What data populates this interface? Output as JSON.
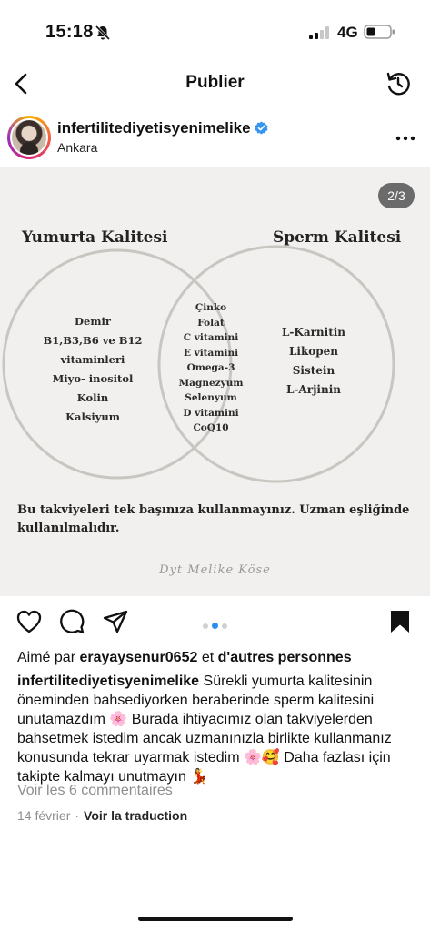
{
  "status_bar": {
    "time": "15:18",
    "network": "4G"
  },
  "header": {
    "title": "Publier"
  },
  "post": {
    "username": "infertilitediyetisyenimelike",
    "location": "Ankara",
    "page_indicator": "2/3"
  },
  "image": {
    "left_title": "Yumurta Kalitesi",
    "right_title": "Sperm Kalitesi",
    "left_items": [
      "Demir",
      "B1,B3,B6 ve B12",
      "vitaminleri",
      "Miyo- inositol",
      "Kolin",
      "Kalsiyum"
    ],
    "center_items": [
      "Çinko",
      "Folat",
      "C vitamini",
      "E vitamini",
      "Omega-3",
      "Magnezyum",
      "Selenyum",
      "D vitamini",
      "CoQ10"
    ],
    "right_items": [
      "L-Karnitin",
      "Likopen",
      "Sistein",
      "L-Arjinin"
    ],
    "warning": "Bu takviyeleri tek başınıza kullanmayınız. Uzman eşliğinde kullanılmalıdır.",
    "signature": "Dyt Melike Köse"
  },
  "likes": {
    "prefix": "Aimé par",
    "user": "erayaysenur0652",
    "middle": "et",
    "suffix": "d'autres personnes"
  },
  "caption": {
    "user": "infertilitediyetisyenimelike",
    "text": "Sürekli yumurta kalitesinin öneminden bahsediyorken beraberinde sperm kalitesini unutamazdım 🌸 Burada ihtiyacımız olan takviyelerden bahsetmek istedim ancak uzmanınızla birlikte kullanmanız konusunda tekrar uyarmak istedim 🌸🥰 Daha fazlası için takipte kalmayı unutmayın 💃"
  },
  "view_comments": "Voir les 6 commentaires",
  "date": "14 février",
  "translate": "Voir la traduction",
  "carousel": {
    "count": 3,
    "active_index": 2
  },
  "colors": {
    "accent": "#2d8cf0",
    "verified": "#3797f0",
    "image_bg": "#f1f0ee"
  },
  "icons": [
    "bell-off-icon",
    "signal-icon",
    "battery-icon",
    "back-icon",
    "refresh-icon",
    "verified-icon",
    "more-icon",
    "heart-icon",
    "comment-icon",
    "send-icon",
    "bookmark-icon"
  ]
}
